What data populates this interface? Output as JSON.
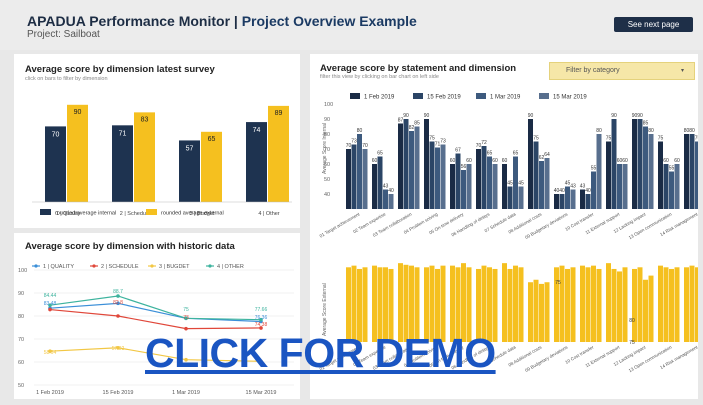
{
  "header": {
    "title_main": "APADUA Performance Monitor | ",
    "title_accent": "Project Overview Example",
    "subtitle": "Project: Sailboat",
    "next_button": "See next page"
  },
  "panels": {
    "latest": {
      "title": "Average score by dimension latest survey",
      "subtitle": "click on bars to filter by dimension"
    },
    "historic": {
      "title": "Average score by dimension with historic data"
    },
    "statement": {
      "title": "Average score by statement and dimension",
      "subtitle": "filter this view by clicking on bar chart on left side"
    }
  },
  "filter": {
    "label": "Filter by category",
    "caret": "▾"
  },
  "demo_link": "CLICK FOR DEMO",
  "colors": {
    "navy": "#1e3350",
    "gold": "#f5c01f",
    "blue": "#3b8fd8",
    "red": "#e0473a",
    "yellow": "#f2c744",
    "teal": "#3db39e"
  },
  "chart_data": [
    {
      "type": "bar",
      "categories": [
        "1 | Quality",
        "2 | Schedule",
        "3 | Budget",
        "4 | Other"
      ],
      "series": [
        {
          "name": "rounded average internal",
          "values": [
            70,
            71,
            57,
            74
          ]
        },
        {
          "name": "rounded average external",
          "values": [
            90,
            83,
            65,
            89
          ]
        }
      ],
      "ylim": [
        0,
        100
      ],
      "legend": "bottom"
    },
    {
      "type": "line",
      "x": [
        "1 Feb 2019",
        "15 Feb 2019",
        "1 Mar 2019",
        "15 Mar 2019"
      ],
      "series": [
        {
          "name": "1 | QUALITY",
          "values": [
            83.4,
            85.5,
            79,
            77.6
          ]
        },
        {
          "name": "2 | SCHEDULE",
          "values": [
            82.8,
            80,
            74.5,
            74.8
          ]
        },
        {
          "name": "3 | BUGDET",
          "values": [
            64.7,
            66.2,
            61,
            60.3
          ]
        },
        {
          "name": "4 | OTHER",
          "values": [
            84.7,
            88.7,
            79,
            78.4
          ]
        }
      ],
      "point_labels": [
        "84.44",
        "83.48",
        "88.7",
        "82.8",
        "75",
        "73",
        "77.66",
        "76.36",
        "58.64",
        "57.92",
        "74.38"
      ],
      "yticks": [
        "100",
        "90",
        "80",
        "70",
        "60",
        "50"
      ],
      "ylim": [
        50,
        100
      ],
      "legend": "top"
    },
    {
      "type": "bar",
      "ylabel": "Average Score Internal",
      "categories": [
        "01 Target achievement",
        "02 Team expertise",
        "03 Team collaboration",
        "04 Problem solving",
        "05 On-time delivery",
        "06 Handling of delays",
        "07 Schedule data",
        "08 Additional costs",
        "09 Budgetary deviations",
        "10 Cost transfer",
        "11 External support",
        "12 Lacking impact",
        "13 Open communication",
        "14 Risk management"
      ],
      "series": [
        {
          "name": "1 Feb 2019",
          "values": [
            70,
            60,
            87,
            90,
            60,
            70,
            60,
            90,
            40,
            43,
            75,
            90,
            75,
            80
          ]
        },
        {
          "name": "15 Feb 2019",
          "values": [
            73,
            65,
            90,
            75,
            67,
            72,
            45,
            75,
            40,
            40,
            90,
            90,
            60,
            80
          ]
        },
        {
          "name": "1 Mar 2019",
          "values": [
            80,
            43,
            82,
            71,
            56,
            65,
            65,
            62,
            45,
            55,
            60,
            85,
            55,
            75
          ]
        },
        {
          "name": "15 Mar 2019",
          "values": [
            70,
            40,
            85,
            73,
            60,
            60,
            45,
            64,
            43,
            80,
            60,
            80,
            60,
            70
          ]
        }
      ],
      "ylim": [
        30,
        100
      ],
      "yticks": [
        "100",
        "90",
        "80",
        "70",
        "60",
        "50",
        "40"
      ],
      "legend": "top"
    },
    {
      "type": "bar",
      "ylabel": "Average Score External",
      "categories": [
        "01 Target achievement",
        "02 Team expertise",
        "03 Team collaboration",
        "04 Problem solving",
        "05 On-time delivery",
        "06 Handling of delays",
        "07 Schedule data",
        "08 Additional costs",
        "09 Budgetary deviations",
        "10 Cost transfer",
        "11 External support",
        "12 Lacking impact",
        "13 Open communication",
        "14 Risk management"
      ],
      "series": [
        {
          "name": "1 Feb 2019",
          "values": [
            90,
            92,
            95,
            90,
            92,
            88,
            95,
            72,
            90,
            92,
            95,
            88,
            92,
            90
          ]
        },
        {
          "name": "15 Feb 2019",
          "values": [
            92,
            90,
            93,
            92,
            90,
            92,
            88,
            75,
            92,
            90,
            88,
            90,
            90,
            92
          ]
        },
        {
          "name": "1 Mar 2019",
          "values": [
            88,
            90,
            92,
            88,
            95,
            90,
            92,
            70,
            88,
            92,
            85,
            75,
            88,
            90
          ]
        },
        {
          "name": "15 Mar 2019",
          "values": [
            90,
            88,
            90,
            92,
            90,
            88,
            90,
            72,
            90,
            88,
            90,
            80,
            90,
            88
          ]
        }
      ],
      "point_labels": [
        "75",
        "80",
        "75"
      ],
      "ylim": [
        0,
        100
      ]
    }
  ]
}
